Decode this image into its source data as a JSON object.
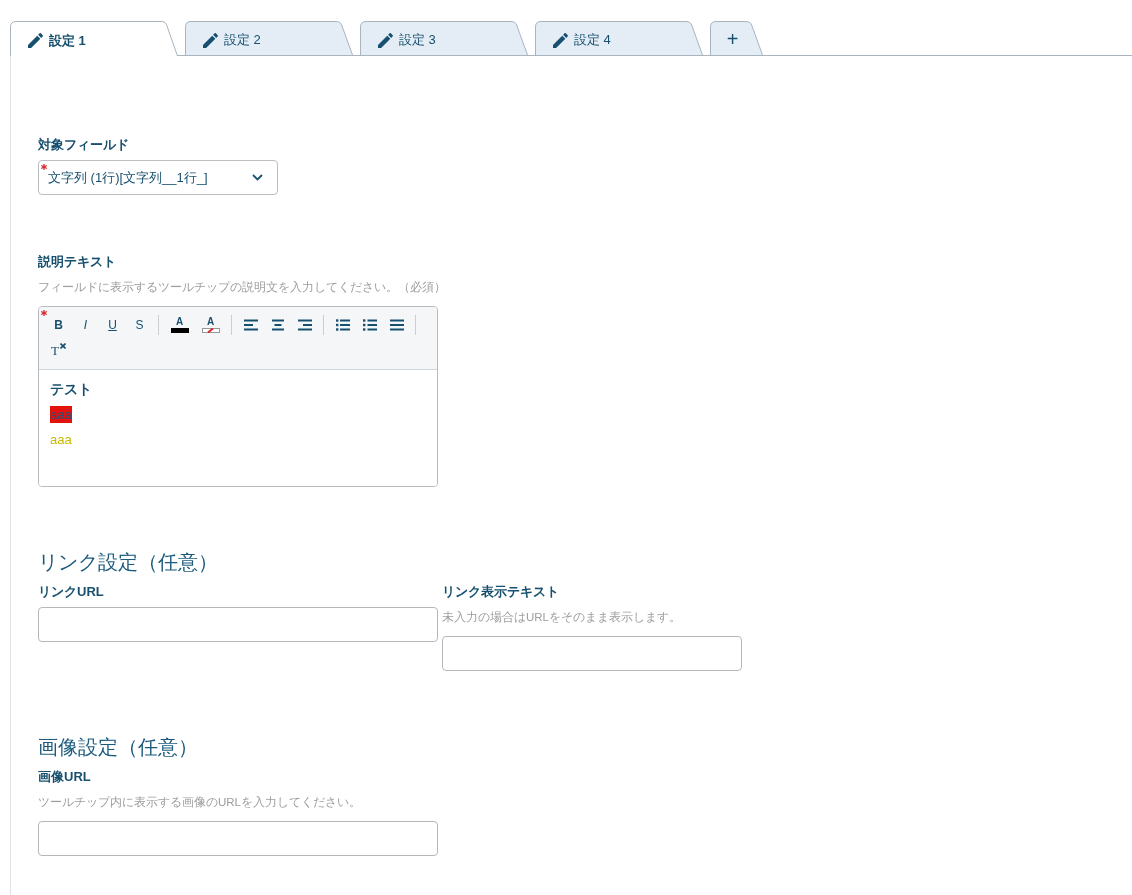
{
  "tabs": [
    {
      "label": "設定 1",
      "selected": true
    },
    {
      "label": "設定 2",
      "selected": false
    },
    {
      "label": "設定 3",
      "selected": false
    },
    {
      "label": "設定 4",
      "selected": false
    }
  ],
  "add_tab": {
    "label": "+"
  },
  "target_field": {
    "label": "対象フィールド",
    "required": true,
    "value": "文字列 (1行)[文字列__1行_]"
  },
  "description": {
    "label": "説明テキスト",
    "hint": "フィールドに表示するツールチップの説明文を入力してください。（必須）",
    "required": true,
    "toolbar_groups": [
      {
        "buttons": [
          {
            "kind": "bold",
            "label": "B"
          },
          {
            "kind": "italic",
            "label": "I"
          },
          {
            "kind": "underline",
            "label": "U"
          },
          {
            "kind": "strike",
            "label": "S"
          }
        ]
      },
      {
        "buttons": [
          {
            "kind": "text-color",
            "label": "A"
          },
          {
            "kind": "background-color",
            "label": "A"
          }
        ]
      },
      {
        "buttons": [
          {
            "kind": "align-left"
          },
          {
            "kind": "align-center"
          },
          {
            "kind": "align-right"
          }
        ]
      },
      {
        "buttons": [
          {
            "kind": "bullet-list"
          },
          {
            "kind": "numbered-list"
          },
          {
            "kind": "justify"
          }
        ]
      },
      {
        "buttons": [
          {
            "kind": "clear-format",
            "label": "T"
          }
        ]
      }
    ],
    "content": [
      {
        "kind": "bold",
        "text": "テスト"
      },
      {
        "kind": "highlight",
        "text": "aaa",
        "color": "#e3120b"
      },
      {
        "kind": "colored",
        "text": "aaa",
        "color": "#c8b900"
      }
    ]
  },
  "link_settings": {
    "heading": "リンク設定（任意）",
    "fields": [
      {
        "label": "リンクURL"
      },
      {
        "label": "リンク表示テキスト",
        "hint": "未入力の場合はURLをそのまま表示します。"
      }
    ]
  },
  "image_settings": {
    "heading": "画像設定（任意）",
    "fields": [
      {
        "label": "画像URL",
        "hint": "ツールチップ内に表示する画像のURLを入力してください。"
      }
    ]
  }
}
